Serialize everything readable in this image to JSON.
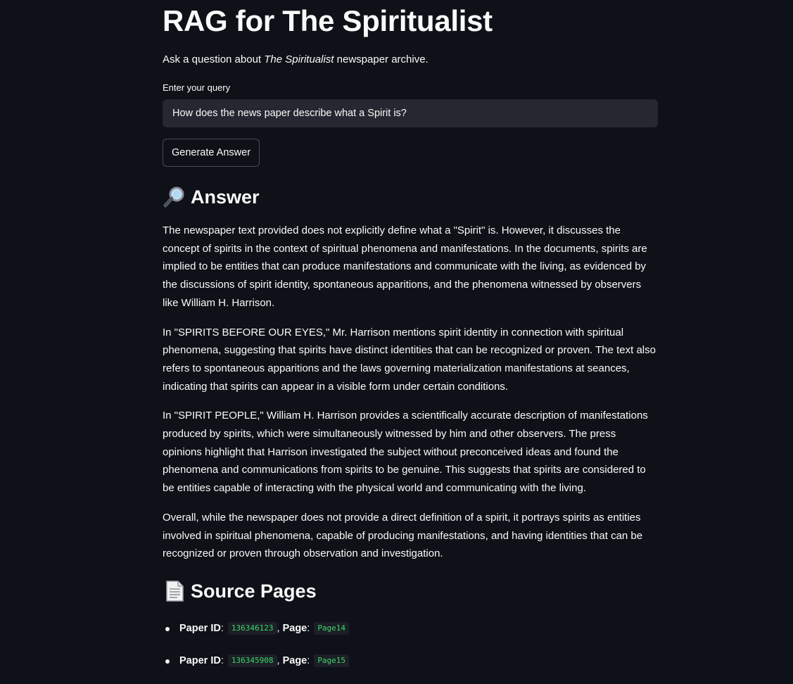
{
  "header": {
    "title": "RAG for The Spiritualist",
    "intro_prefix": "Ask a question about ",
    "intro_italic": "The Spiritualist",
    "intro_suffix": " newspaper archive."
  },
  "query": {
    "label": "Enter your query",
    "value": "How does the news paper describe what a Spirit is?"
  },
  "actions": {
    "generate_label": "Generate Answer"
  },
  "answer": {
    "heading": "Answer",
    "icon": "magnifying-glass-icon",
    "paragraphs": [
      "The newspaper text provided does not explicitly define what a \"Spirit\" is. However, it discusses the concept of spirits in the context of spiritual phenomena and manifestations. In the documents, spirits are implied to be entities that can produce manifestations and communicate with the living, as evidenced by the discussions of spirit identity, spontaneous apparitions, and the phenomena witnessed by observers like William H. Harrison.",
      "In \"SPIRITS BEFORE OUR EYES,\" Mr. Harrison mentions spirit identity in connection with spiritual phenomena, suggesting that spirits have distinct identities that can be recognized or proven. The text also refers to spontaneous apparitions and the laws governing materialization manifestations at seances, indicating that spirits can appear in a visible form under certain conditions.",
      "In \"SPIRIT PEOPLE,\" William H. Harrison provides a scientifically accurate description of manifestations produced by spirits, which were simultaneously witnessed by him and other observers. The press opinions highlight that Harrison investigated the subject without preconceived ideas and found the phenomena and communications from spirits to be genuine. This suggests that spirits are considered to be entities capable of interacting with the physical world and communicating with the living.",
      "Overall, while the newspaper does not provide a direct definition of a spirit, it portrays spirits as entities involved in spiritual phenomena, capable of producing manifestations, and having identities that can be recognized or proven through observation and investigation."
    ]
  },
  "sources": {
    "heading": "Source Pages",
    "icon": "page-document-icon",
    "paper_id_label": "Paper ID",
    "page_label": "Page",
    "items": [
      {
        "paper_id": "136346123",
        "page": "Page14"
      },
      {
        "paper_id": "136345908",
        "page": "Page15"
      }
    ]
  },
  "colors": {
    "background": "#0e1117",
    "text": "#fafafa",
    "input_bg": "#262730",
    "code_text": "#3dd56d",
    "code_bg": "#1c1f26"
  }
}
